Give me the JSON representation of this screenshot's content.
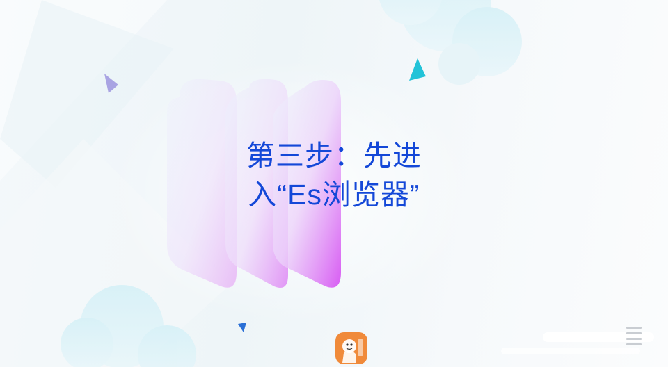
{
  "slide": {
    "title_line1": "第三步：先进",
    "title_line2": "入“Es浏览器”"
  },
  "colors": {
    "title": "#1448d8",
    "triangle_teal": "#22c3d8",
    "triangle_purple": "#a9a4e3",
    "triangle_blue": "#2a6fd6",
    "panel_gradient_top": "#e6eefc",
    "panel_gradient_bottom": "#e14cf4",
    "badge": "#f08a3a"
  },
  "decorations": {
    "badge_icon": "app-logo-icon",
    "corner_icon": "menu-lines-icon"
  }
}
